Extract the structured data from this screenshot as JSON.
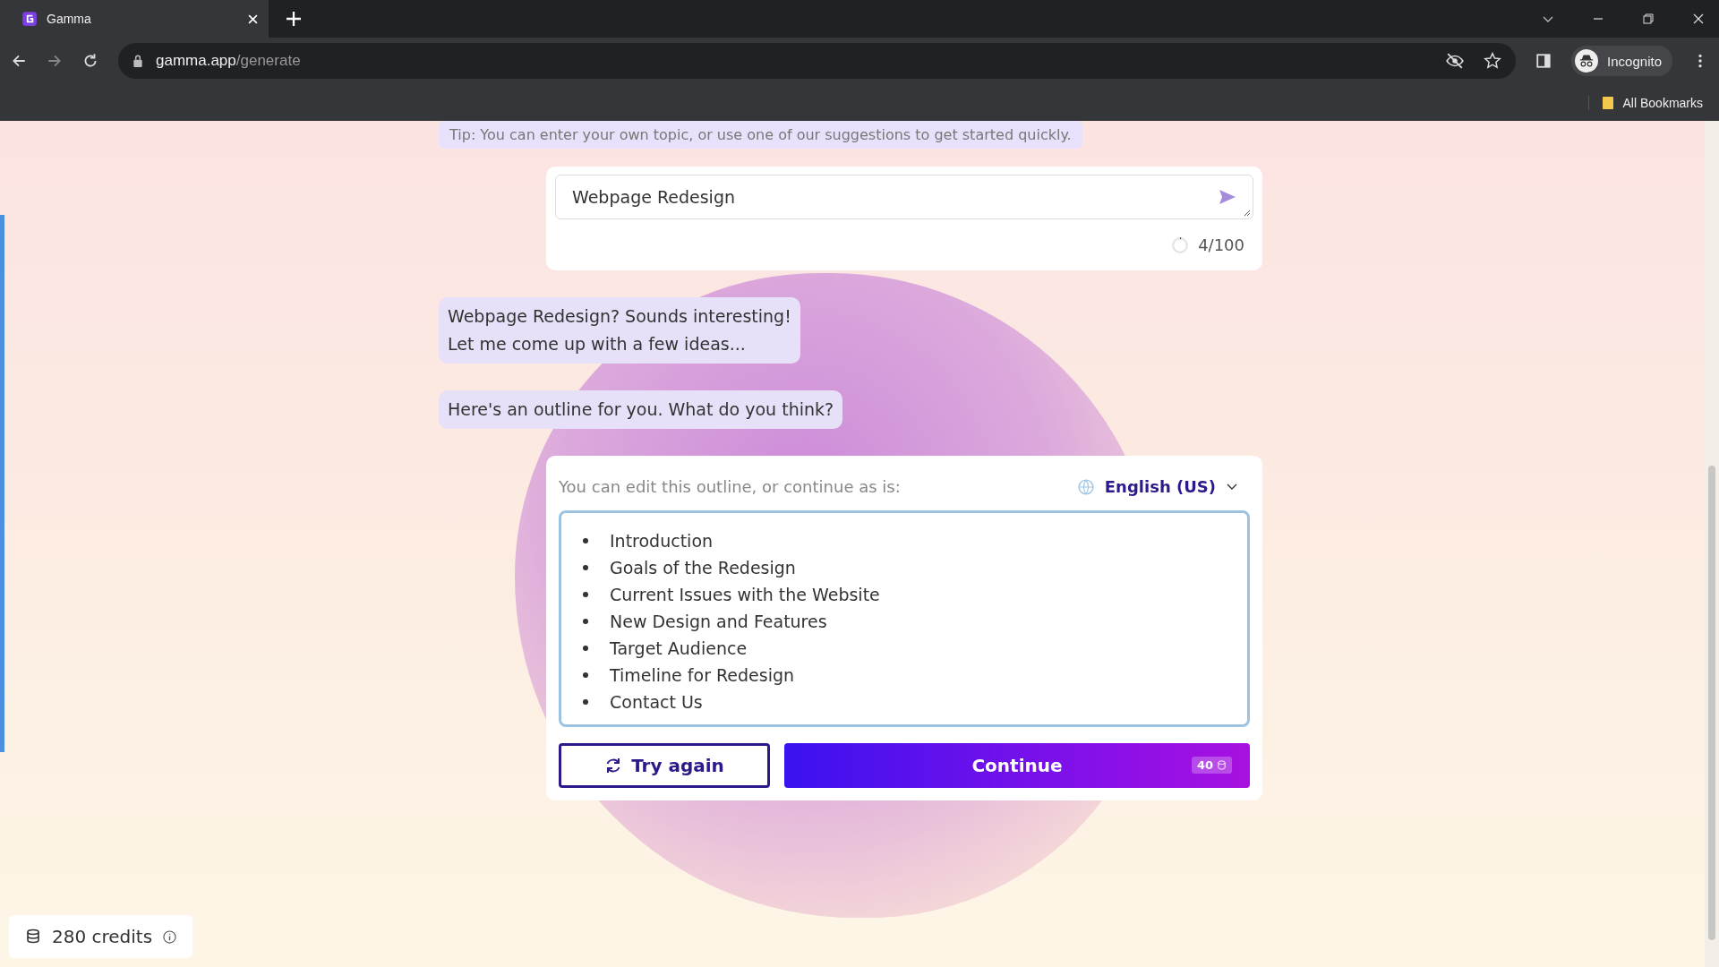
{
  "browser": {
    "tab_title": "Gamma",
    "host": "gamma.app",
    "path": "/generate",
    "profile": "Incognito",
    "bookmarks": "All Bookmarks"
  },
  "tip": "Tip: You can enter your own topic, or use one of our suggestions to get started quickly.",
  "prompt": {
    "value": "Webpage Redesign",
    "counter": "4/100"
  },
  "messages": [
    {
      "text": "Webpage Redesign? Sounds interesting!\nLet me come up with a few ideas..."
    },
    {
      "text": "Here's an outline for you. What do you think?"
    }
  ],
  "outline": {
    "hint": "You can edit this outline, or continue as is:",
    "language": "English (US)",
    "items": [
      "Introduction",
      "Goals of the Redesign",
      "Current Issues with the Website",
      "New Design and Features",
      "Target Audience",
      "Timeline for Redesign",
      "Contact Us"
    ]
  },
  "actions": {
    "retry": "Try again",
    "continue": "Continue",
    "cost": "40"
  },
  "credits": "280 credits"
}
